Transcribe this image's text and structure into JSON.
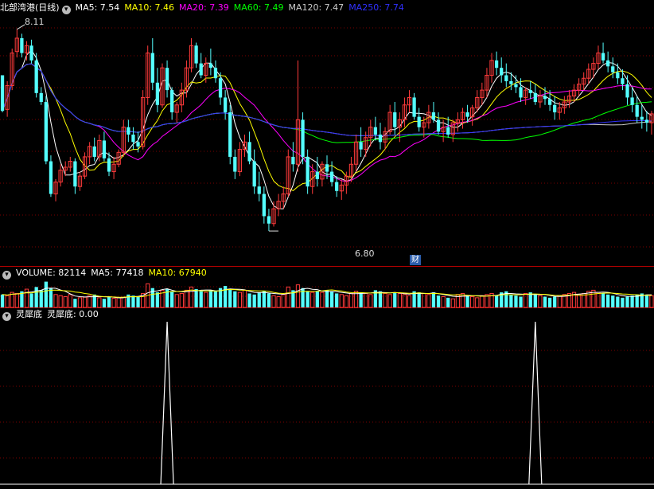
{
  "colors": {
    "up": "#ff3b3b",
    "down": "#54ffff",
    "ma5": "#ffffff",
    "ma10": "#ffff00",
    "ma20": "#ff00ff",
    "ma60": "#00ff00",
    "ma120": "#cccccc",
    "ma250": "#3030ff",
    "grid": "#7a0000",
    "separator": "#b00000",
    "signal": "#ffffff"
  },
  "price_header": {
    "stock_name": "北部湾港(日线)",
    "ma5": "MA5: 7.54",
    "ma10": "MA10: 7.46",
    "ma20": "MA20: 7.39",
    "ma60": "MA60: 7.49",
    "ma120": "MA120: 7.47",
    "ma250": "MA250: 7.74"
  },
  "price_annotations": {
    "high_label": "8.11",
    "low_label": "6.80",
    "event_badge": "财"
  },
  "volume_header": {
    "title": "VOLUME: 82114",
    "ma5": "MA5: 77418",
    "ma10": "MA10: 67940"
  },
  "indicator_header": {
    "name": "灵犀底",
    "value": "灵犀底: 0.00"
  },
  "chart_data": [
    {
      "type": "candlestick",
      "ylim": [
        6.6,
        8.2
      ],
      "n_bars": 135,
      "ohlc": [
        [
          7.8,
          7.78,
          7.55,
          7.56
        ],
        [
          7.57,
          7.76,
          7.52,
          7.73
        ],
        [
          7.73,
          7.98,
          7.7,
          7.95
        ],
        [
          7.96,
          8.11,
          7.92,
          8.05
        ],
        [
          8.05,
          8.08,
          7.92,
          7.95
        ],
        [
          7.95,
          8.03,
          7.9,
          8
        ],
        [
          8.0,
          8.04,
          7.88,
          7.9
        ],
        [
          7.9,
          7.95,
          7.65,
          7.68
        ],
        [
          7.68,
          7.72,
          7.6,
          7.62
        ],
        [
          7.62,
          7.66,
          7.2,
          7.22
        ],
        [
          7.22,
          7.26,
          6.98,
          7.0
        ],
        [
          7.0,
          7.1,
          6.95,
          7.08
        ],
        [
          7.08,
          7.2,
          7.05,
          7.16
        ],
        [
          7.16,
          7.22,
          7.12,
          7.18
        ],
        [
          7.18,
          7.25,
          7.15,
          7.22
        ],
        [
          7.22,
          7.24,
          7.0,
          7.05
        ],
        [
          7.05,
          7.15,
          7.02,
          7.12
        ],
        [
          7.12,
          7.28,
          7.1,
          7.25
        ],
        [
          7.25,
          7.35,
          7.2,
          7.32
        ],
        [
          7.32,
          7.38,
          7.22,
          7.25
        ],
        [
          7.25,
          7.4,
          7.22,
          7.36
        ],
        [
          7.36,
          7.42,
          7.22,
          7.24
        ],
        [
          7.24,
          7.28,
          7.12,
          7.15
        ],
        [
          7.15,
          7.25,
          7.1,
          7.2
        ],
        [
          7.2,
          7.3,
          7.18,
          7.28
        ],
        [
          7.28,
          7.5,
          7.25,
          7.45
        ],
        [
          7.45,
          7.5,
          7.35,
          7.4
        ],
        [
          7.4,
          7.45,
          7.3,
          7.35
        ],
        [
          7.35,
          7.42,
          7.28,
          7.32
        ],
        [
          7.32,
          7.7,
          7.3,
          7.65
        ],
        [
          7.65,
          8.0,
          7.6,
          7.95
        ],
        [
          7.95,
          8.05,
          7.7,
          7.75
        ],
        [
          7.75,
          7.85,
          7.55,
          7.6
        ],
        [
          7.6,
          7.88,
          7.58,
          7.85
        ],
        [
          7.85,
          7.9,
          7.65,
          7.7
        ],
        [
          7.7,
          7.72,
          7.5,
          7.55
        ],
        [
          7.55,
          7.62,
          7.48,
          7.6
        ],
        [
          7.6,
          7.75,
          7.55,
          7.7
        ],
        [
          7.7,
          7.9,
          7.65,
          7.85
        ],
        [
          7.85,
          8.05,
          7.82,
          8.0
        ],
        [
          8.0,
          8.02,
          7.85,
          7.88
        ],
        [
          7.88,
          7.95,
          7.78,
          7.8
        ],
        [
          7.8,
          7.92,
          7.75,
          7.88
        ],
        [
          7.88,
          7.98,
          7.8,
          7.85
        ],
        [
          7.85,
          7.9,
          7.75,
          7.78
        ],
        [
          7.78,
          7.82,
          7.6,
          7.65
        ],
        [
          7.65,
          7.7,
          7.5,
          7.55
        ],
        [
          7.55,
          7.6,
          7.2,
          7.25
        ],
        [
          7.25,
          7.3,
          7.1,
          7.15
        ],
        [
          7.15,
          7.35,
          7.12,
          7.3
        ],
        [
          7.3,
          7.4,
          7.25,
          7.35
        ],
        [
          7.35,
          7.42,
          7.2,
          7.22
        ],
        [
          7.22,
          7.3,
          7.0,
          7.05
        ],
        [
          7.05,
          7.15,
          6.95,
          7.0
        ],
        [
          7.0,
          7.05,
          6.8,
          6.85
        ],
        [
          6.85,
          6.9,
          6.75,
          6.8
        ],
        [
          6.8,
          6.95,
          6.78,
          6.9
        ],
        [
          6.9,
          7.0,
          6.85,
          6.95
        ],
        [
          6.95,
          7.05,
          6.9,
          7.0
        ],
        [
          7.0,
          7.3,
          6.98,
          7.25
        ],
        [
          7.25,
          7.35,
          7.15,
          7.2
        ],
        [
          7.2,
          7.9,
          7.15,
          7.5
        ],
        [
          7.5,
          7.55,
          7.2,
          7.25
        ],
        [
          7.25,
          7.3,
          7.0,
          7.05
        ],
        [
          7.05,
          7.2,
          7.0,
          7.15
        ],
        [
          7.15,
          7.25,
          7.05,
          7.1
        ],
        [
          7.1,
          7.22,
          7.05,
          7.2
        ],
        [
          7.2,
          7.26,
          7.1,
          7.15
        ],
        [
          7.15,
          7.22,
          7.05,
          7.08
        ],
        [
          7.08,
          7.12,
          6.98,
          7.02
        ],
        [
          7.02,
          7.1,
          6.96,
          7.06
        ],
        [
          7.06,
          7.15,
          7.0,
          7.12
        ],
        [
          7.12,
          7.25,
          7.08,
          7.2
        ],
        [
          7.2,
          7.4,
          7.15,
          7.35
        ],
        [
          7.35,
          7.45,
          7.25,
          7.3
        ],
        [
          7.3,
          7.42,
          7.25,
          7.38
        ],
        [
          7.38,
          7.5,
          7.32,
          7.45
        ],
        [
          7.45,
          7.52,
          7.36,
          7.4
        ],
        [
          7.4,
          7.48,
          7.3,
          7.35
        ],
        [
          7.35,
          7.45,
          7.3,
          7.42
        ],
        [
          7.42,
          7.6,
          7.4,
          7.55
        ],
        [
          7.55,
          7.62,
          7.4,
          7.45
        ],
        [
          7.45,
          7.55,
          7.35,
          7.5
        ],
        [
          7.5,
          7.65,
          7.45,
          7.6
        ],
        [
          7.6,
          7.7,
          7.55,
          7.65
        ],
        [
          7.65,
          7.68,
          7.5,
          7.52
        ],
        [
          7.52,
          7.58,
          7.42,
          7.45
        ],
        [
          7.45,
          7.52,
          7.38,
          7.48
        ],
        [
          7.48,
          7.6,
          7.44,
          7.55
        ],
        [
          7.55,
          7.62,
          7.48,
          7.5
        ],
        [
          7.5,
          7.55,
          7.4,
          7.42
        ],
        [
          7.42,
          7.5,
          7.35,
          7.45
        ],
        [
          7.45,
          7.52,
          7.38,
          7.4
        ],
        [
          7.4,
          7.5,
          7.35,
          7.48
        ],
        [
          7.48,
          7.55,
          7.42,
          7.5
        ],
        [
          7.5,
          7.58,
          7.44,
          7.55
        ],
        [
          7.55,
          7.6,
          7.48,
          7.52
        ],
        [
          7.52,
          7.6,
          7.46,
          7.58
        ],
        [
          7.58,
          7.7,
          7.55,
          7.65
        ],
        [
          7.65,
          7.75,
          7.6,
          7.7
        ],
        [
          7.7,
          7.85,
          7.65,
          7.8
        ],
        [
          7.8,
          7.95,
          7.75,
          7.9
        ],
        [
          7.9,
          7.96,
          7.8,
          7.85
        ],
        [
          7.85,
          7.92,
          7.75,
          7.8
        ],
        [
          7.8,
          7.88,
          7.72,
          7.76
        ],
        [
          7.76,
          7.82,
          7.7,
          7.74
        ],
        [
          7.74,
          7.8,
          7.68,
          7.72
        ],
        [
          7.72,
          7.78,
          7.62,
          7.65
        ],
        [
          7.65,
          7.72,
          7.6,
          7.7
        ],
        [
          7.7,
          7.76,
          7.64,
          7.68
        ],
        [
          7.68,
          7.74,
          7.6,
          7.62
        ],
        [
          7.62,
          7.7,
          7.58,
          7.66
        ],
        [
          7.66,
          7.72,
          7.6,
          7.64
        ],
        [
          7.64,
          7.7,
          7.56,
          7.6
        ],
        [
          7.6,
          7.66,
          7.5,
          7.55
        ],
        [
          7.55,
          7.62,
          7.5,
          7.58
        ],
        [
          7.58,
          7.66,
          7.54,
          7.62
        ],
        [
          7.62,
          7.7,
          7.58,
          7.66
        ],
        [
          7.66,
          7.74,
          7.62,
          7.7
        ],
        [
          7.7,
          7.78,
          7.66,
          7.74
        ],
        [
          7.74,
          7.82,
          7.7,
          7.78
        ],
        [
          7.78,
          7.88,
          7.74,
          7.84
        ],
        [
          7.84,
          7.92,
          7.78,
          7.88
        ],
        [
          7.88,
          8.0,
          7.84,
          7.95
        ],
        [
          7.95,
          8.02,
          7.88,
          7.9
        ],
        [
          7.9,
          7.96,
          7.82,
          7.86
        ],
        [
          7.86,
          7.92,
          7.78,
          7.82
        ],
        [
          7.82,
          7.88,
          7.74,
          7.78
        ],
        [
          7.78,
          7.84,
          7.7,
          7.74
        ],
        [
          7.74,
          7.8,
          7.6,
          7.65
        ],
        [
          7.65,
          7.72,
          7.55,
          7.6
        ],
        [
          7.6,
          7.66,
          7.48,
          7.52
        ],
        [
          7.52,
          7.6,
          7.44,
          7.5
        ],
        [
          7.5,
          7.56,
          7.42,
          7.48
        ],
        [
          7.48,
          7.56,
          7.4,
          7.54
        ]
      ]
    },
    {
      "type": "bar",
      "values": [
        120,
        110,
        140,
        130,
        150,
        170,
        130,
        190,
        160,
        240,
        180,
        120,
        110,
        100,
        120,
        80,
        90,
        95,
        110,
        120,
        90,
        80,
        100,
        85,
        90,
        95,
        120,
        110,
        100,
        130,
        220,
        180,
        140,
        160,
        170,
        150,
        120,
        130,
        160,
        190,
        170,
        150,
        140,
        160,
        150,
        180,
        200,
        170,
        150,
        140,
        160,
        130,
        120,
        140,
        150,
        130,
        110,
        100,
        120,
        190,
        160,
        210,
        180,
        150,
        140,
        150,
        140,
        160,
        150,
        130,
        120,
        110,
        130,
        150,
        140,
        130,
        120,
        160,
        150,
        130,
        120,
        140,
        130,
        120,
        110,
        150,
        140,
        130,
        120,
        140,
        110,
        100,
        90,
        80,
        120,
        130,
        110,
        100,
        90,
        110,
        120,
        130,
        110,
        140,
        150,
        120,
        110,
        100,
        130,
        140,
        120,
        110,
        100,
        90,
        100,
        110,
        120,
        130,
        140,
        120,
        130,
        150,
        160,
        140,
        130,
        120,
        110,
        100,
        90,
        100,
        110,
        120,
        130,
        120,
        110
      ],
      "ma5": 77418,
      "ma10": 67940
    },
    {
      "type": "line",
      "series": [
        {
          "name": "灵犀底",
          "signal_bars": [
            34,
            110
          ]
        }
      ],
      "value": 0.0
    }
  ]
}
